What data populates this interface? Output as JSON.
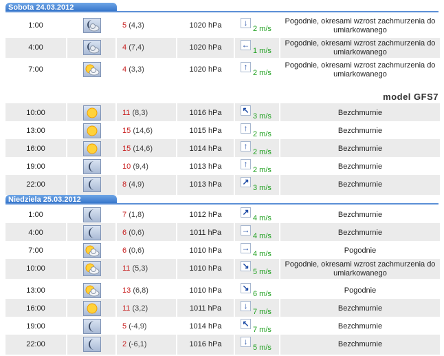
{
  "model_label": "model GFS7",
  "days": [
    {
      "label": "Sobota 24.03.2012",
      "rows": [
        {
          "time": "1:00",
          "icon": "cloudy-moon-icon",
          "temp": "5",
          "feel": "(4,3)",
          "pressure": "1020 hPa",
          "wind_dir": "down",
          "wind": "2 m/s",
          "desc": "Pogodnie, okresami wzrost zachmurzenia do umiarkowanego"
        },
        {
          "time": "4:00",
          "icon": "cloudy-moon-icon",
          "temp": "4",
          "feel": "(7,4)",
          "pressure": "1020 hPa",
          "wind_dir": "left",
          "wind": "1 m/s",
          "desc": "Pogodnie, okresami wzrost zachmurzenia do umiarkowanego"
        },
        {
          "time": "7:00",
          "icon": "sun-cloud-icon",
          "temp": "4",
          "feel": "(3,3)",
          "pressure": "1020 hPa",
          "wind_dir": "up",
          "wind": "2 m/s",
          "desc": "Pogodnie, okresami wzrost zachmurzenia do umiarkowanego"
        },
        {
          "time": "10:00",
          "icon": "sun-icon",
          "temp": "11",
          "feel": "(8,3)",
          "pressure": "1016 hPa",
          "wind_dir": "up-left",
          "wind": "3 m/s",
          "desc": "Bezchmurnie"
        },
        {
          "time": "13:00",
          "icon": "sun-icon",
          "temp": "15",
          "feel": "(14,6)",
          "pressure": "1015 hPa",
          "wind_dir": "up",
          "wind": "2 m/s",
          "desc": "Bezchmurnie"
        },
        {
          "time": "16:00",
          "icon": "sun-icon",
          "temp": "15",
          "feel": "(14,6)",
          "pressure": "1014 hPa",
          "wind_dir": "up",
          "wind": "2 m/s",
          "desc": "Bezchmurnie"
        },
        {
          "time": "19:00",
          "icon": "moon-icon",
          "temp": "10",
          "feel": "(9,4)",
          "pressure": "1013 hPa",
          "wind_dir": "up",
          "wind": "2 m/s",
          "desc": "Bezchmurnie"
        },
        {
          "time": "22:00",
          "icon": "moon-icon",
          "temp": "8",
          "feel": "(4,9)",
          "pressure": "1013 hPa",
          "wind_dir": "up-right",
          "wind": "3 m/s",
          "desc": "Bezchmurnie"
        }
      ]
    },
    {
      "label": "Niedziela 25.03.2012",
      "rows": [
        {
          "time": "1:00",
          "icon": "moon-icon",
          "temp": "7",
          "feel": "(1,8)",
          "pressure": "1012 hPa",
          "wind_dir": "up-right",
          "wind": "4 m/s",
          "desc": "Bezchmurnie"
        },
        {
          "time": "4:00",
          "icon": "moon-icon",
          "temp": "6",
          "feel": "(0,6)",
          "pressure": "1011 hPa",
          "wind_dir": "right",
          "wind": "4 m/s",
          "desc": "Bezchmurnie"
        },
        {
          "time": "7:00",
          "icon": "sun-cloud-icon",
          "temp": "6",
          "feel": "(0,6)",
          "pressure": "1010 hPa",
          "wind_dir": "right",
          "wind": "4 m/s",
          "desc": "Pogodnie"
        },
        {
          "time": "10:00",
          "icon": "sun-cloud-icon",
          "temp": "11",
          "feel": "(5,3)",
          "pressure": "1010 hPa",
          "wind_dir": "down-right",
          "wind": "5 m/s",
          "desc": "Pogodnie, okresami wzrost zachmurzenia do umiarkowanego"
        },
        {
          "time": "13:00",
          "icon": "sun-cloud-icon",
          "temp": "13",
          "feel": "(6,8)",
          "pressure": "1010 hPa",
          "wind_dir": "down-right",
          "wind": "6 m/s",
          "desc": "Pogodnie"
        },
        {
          "time": "16:00",
          "icon": "sun-icon",
          "temp": "11",
          "feel": "(3,2)",
          "pressure": "1011 hPa",
          "wind_dir": "down",
          "wind": "7 m/s",
          "desc": "Bezchmurnie"
        },
        {
          "time": "19:00",
          "icon": "moon-icon",
          "temp": "5",
          "feel": "(-4,9)",
          "pressure": "1014 hPa",
          "wind_dir": "up-left",
          "wind": "7 m/s",
          "desc": "Bezchmurnie"
        },
        {
          "time": "22:00",
          "icon": "moon-icon",
          "temp": "2",
          "feel": "(-6,1)",
          "pressure": "1016 hPa",
          "wind_dir": "down",
          "wind": "5 m/s",
          "desc": "Bezchmurnie"
        }
      ]
    }
  ]
}
